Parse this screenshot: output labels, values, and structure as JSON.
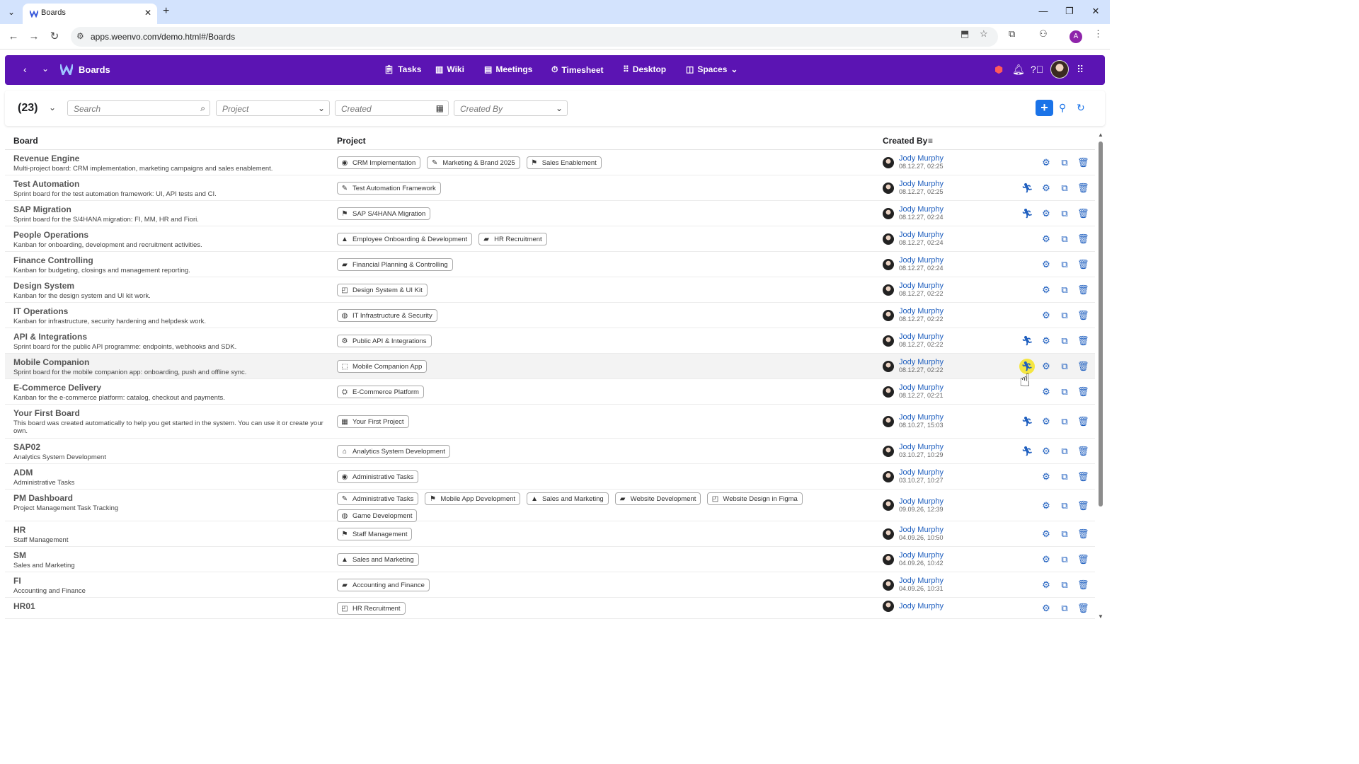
{
  "browser": {
    "tab_title": "Boards",
    "url": "apps.weenvo.com/demo.html#/Boards",
    "profile_initial": "A"
  },
  "header": {
    "title": "Boards",
    "nav": [
      {
        "label": "Tasks",
        "icon": "clipboard-icon"
      },
      {
        "label": "Wiki",
        "icon": "book-icon"
      },
      {
        "label": "Meetings",
        "icon": "meetings-icon"
      },
      {
        "label": "Timesheet",
        "icon": "timesheet-icon"
      },
      {
        "label": "Desktop",
        "icon": "grid-icon"
      },
      {
        "label": "Spaces",
        "icon": "spaces-icon"
      }
    ]
  },
  "filters": {
    "count": "(23)",
    "search_placeholder": "Search",
    "project_placeholder": "Project",
    "created_placeholder": "Created",
    "created_by_placeholder": "Created By"
  },
  "table": {
    "col_board": "Board",
    "col_project": "Project",
    "col_created_by": "Created By",
    "rows": [
      {
        "title": "Revenue Engine",
        "desc": "Multi-project board: CRM implementation, marketing campaigns and sales enablement.",
        "projects": [
          "CRM Implementation",
          "Marketing & Brand 2025",
          "Sales Enablement"
        ],
        "creator": "Jody Murphy",
        "date": "08.12.27, 02:25",
        "sprint": false
      },
      {
        "title": "Test Automation",
        "desc": "Sprint board for the test automation framework: UI, API tests and CI.",
        "projects": [
          "Test Automation Framework"
        ],
        "creator": "Jody Murphy",
        "date": "08.12.27, 02:25",
        "sprint": true
      },
      {
        "title": "SAP Migration",
        "desc": "Sprint board for the S/4HANA migration: FI, MM, HR and Fiori.",
        "projects": [
          "SAP S/4HANA Migration"
        ],
        "creator": "Jody Murphy",
        "date": "08.12.27, 02:24",
        "sprint": true
      },
      {
        "title": "People Operations",
        "desc": "Kanban for onboarding, development and recruitment activities.",
        "projects": [
          "Employee Onboarding & Development",
          "HR Recruitment"
        ],
        "creator": "Jody Murphy",
        "date": "08.12.27, 02:24",
        "sprint": false
      },
      {
        "title": "Finance Controlling",
        "desc": "Kanban for budgeting, closings and management reporting.",
        "projects": [
          "Financial Planning & Controlling"
        ],
        "creator": "Jody Murphy",
        "date": "08.12.27, 02:24",
        "sprint": false
      },
      {
        "title": "Design System",
        "desc": "Kanban for the design system and UI kit work.",
        "projects": [
          "Design System & UI Kit"
        ],
        "creator": "Jody Murphy",
        "date": "08.12.27, 02:22",
        "sprint": false
      },
      {
        "title": "IT Operations",
        "desc": "Kanban for infrastructure, security hardening and helpdesk work.",
        "projects": [
          "IT Infrastructure & Security"
        ],
        "creator": "Jody Murphy",
        "date": "08.12.27, 02:22",
        "sprint": false
      },
      {
        "title": "API & Integrations",
        "desc": "Sprint board for the public API programme: endpoints, webhooks and SDK.",
        "projects": [
          "Public API & Integrations"
        ],
        "creator": "Jody Murphy",
        "date": "08.12.27, 02:22",
        "sprint": true
      },
      {
        "title": "Mobile Companion",
        "desc": "Sprint board for the mobile companion app: onboarding, push and offline sync.",
        "projects": [
          "Mobile Companion App"
        ],
        "creator": "Jody Murphy",
        "date": "08.12.27, 02:22",
        "sprint": true
      },
      {
        "title": "E-Commerce Delivery",
        "desc": "Kanban for the e-commerce platform: catalog, checkout and payments.",
        "projects": [
          "E-Commerce Platform"
        ],
        "creator": "Jody Murphy",
        "date": "08.12.27, 02:21",
        "sprint": false
      },
      {
        "title": "Your First Board",
        "desc": "This board was created automatically to help you get started in the system. You can use it or create your own.",
        "projects": [
          "Your First Project"
        ],
        "creator": "Jody Murphy",
        "date": "08.10.27, 15:03",
        "sprint": true
      },
      {
        "title": "SAP02",
        "desc": "Analytics System Development",
        "projects": [
          "Analytics System Development"
        ],
        "creator": "Jody Murphy",
        "date": "03.10.27, 10:29",
        "sprint": true
      },
      {
        "title": "ADM",
        "desc": "Administrative Tasks",
        "projects": [
          "Administrative Tasks"
        ],
        "creator": "Jody Murphy",
        "date": "03.10.27, 10:27",
        "sprint": false
      },
      {
        "title": "PM Dashboard",
        "desc": "Project Management Task Tracking",
        "projects": [
          "Administrative Tasks",
          "Mobile App Development",
          "Sales and Marketing",
          "Website Development",
          "Website Design in Figma",
          "Game Development"
        ],
        "creator": "Jody Murphy",
        "date": "09.09.26, 12:39",
        "sprint": false
      },
      {
        "title": "HR",
        "desc": "Staff Management",
        "projects": [
          "Staff Management"
        ],
        "creator": "Jody Murphy",
        "date": "04.09.26, 10:50",
        "sprint": false
      },
      {
        "title": "SM",
        "desc": "Sales and Marketing",
        "projects": [
          "Sales and Marketing"
        ],
        "creator": "Jody Murphy",
        "date": "04.09.26, 10:42",
        "sprint": false
      },
      {
        "title": "FI",
        "desc": "Accounting and Finance",
        "projects": [
          "Accounting and Finance"
        ],
        "creator": "Jody Murphy",
        "date": "04.09.26, 10:31",
        "sprint": false
      },
      {
        "title": "HR01",
        "desc": "",
        "projects": [
          "HR Recruitment"
        ],
        "creator": "Jody Murphy",
        "date": "",
        "sprint": false
      }
    ]
  },
  "colors": {
    "header_bg": "#5b14b3",
    "accent": "#1a73e8",
    "link": "#1f5fbf",
    "hover_highlight": "#f5e642"
  }
}
